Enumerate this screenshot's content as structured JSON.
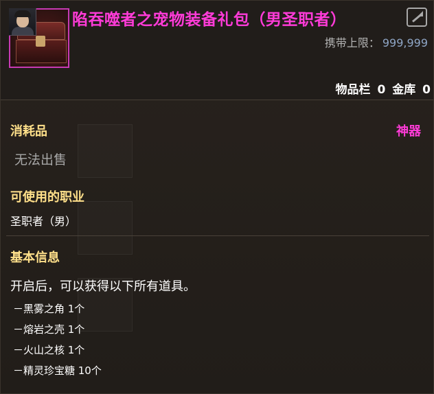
{
  "item": {
    "name": "陷吞噬者之宠物装备礼包（男圣职者）",
    "carry_limit_label": "携带上限：",
    "carry_limit_value": "999,999",
    "inventory_label": "物品栏",
    "inventory_count": "0",
    "bank_label": "金库",
    "bank_count": "0"
  },
  "details": {
    "type": "消耗品",
    "rarity": "神器",
    "tradability": "无法出售",
    "jobs_title": "可使用的职业",
    "jobs_value": "圣职者（男）",
    "basic_info_title": "基本信息",
    "open_description": "开启后，可以获得以下所有道具。",
    "rewards": [
      "－黑雾之角 1个",
      "－熔岩之壳 1个",
      "－火山之核 1个",
      "－精灵珍宝糖 10个"
    ]
  },
  "colors": {
    "rarity": "#ff3bd8",
    "section_title": "#ffe08a",
    "carry_value": "#8fa6c6"
  },
  "icons": {
    "share": "share-icon",
    "item": "treasure-chest-icon",
    "class": "character-avatar-icon"
  }
}
